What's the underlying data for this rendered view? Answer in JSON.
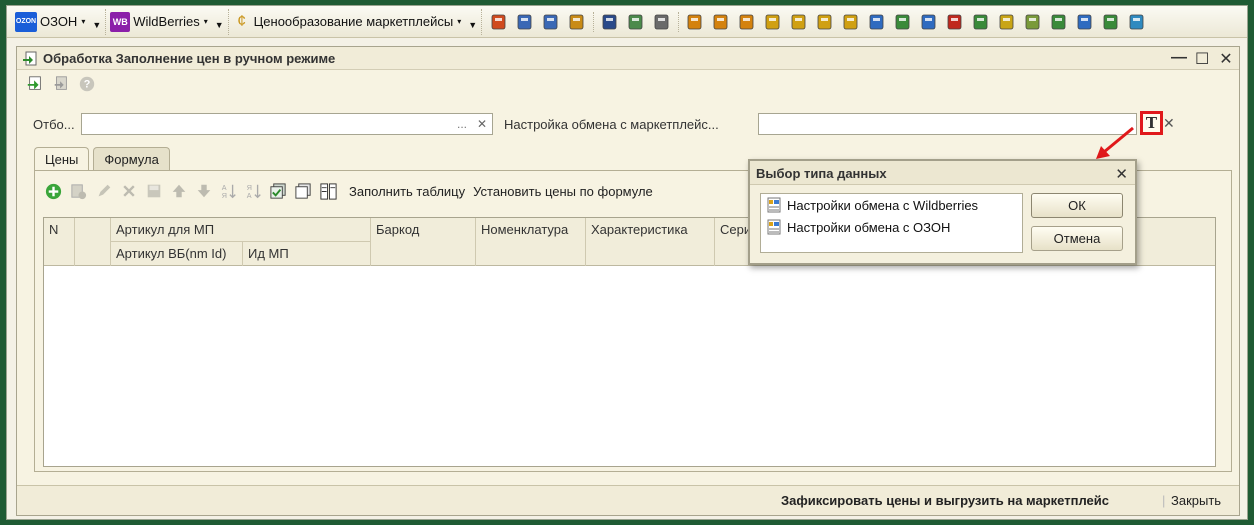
{
  "toolbar": {
    "ozon_label": "ОЗОН",
    "ozon_logo": "OZON",
    "wb_label": "WildBerries",
    "wb_logo": "WB",
    "pricing_label": "Ценообразование маркетплейсы",
    "icons": [
      "book-icon",
      "print-icon",
      "printer-icon",
      "printer2-icon",
      "users-icon",
      "table-icon",
      "chart-icon",
      "money-icon",
      "money2-icon",
      "money3-icon",
      "coins-icon",
      "bars-icon",
      "coins2-icon",
      "currency-icon",
      "export-icon",
      "transfer-icon",
      "export2-icon",
      "transfer2-icon",
      "transfer3-icon",
      "stack-icon",
      "document-icon",
      "transfer4-icon",
      "export3-icon",
      "refresh-icon",
      "add-table-icon"
    ]
  },
  "window": {
    "title": "Обработка  Заполнение цен в ручном режиме",
    "controls": {
      "minimize": "—",
      "maximize": "☐",
      "close": "✕"
    }
  },
  "form": {
    "filter_label": "Отбо...",
    "filter_value": "",
    "filter_choose": "...",
    "exchange_label": "Настройка обмена с маркетплейс...",
    "exchange_value": "",
    "type_button": "T"
  },
  "tabs": [
    {
      "label": "Цены",
      "active": true
    },
    {
      "label": "Формула",
      "active": false
    }
  ],
  "tab_toolbar": {
    "fill_table": "Заполнить таблицу",
    "set_prices": "Установить цены по формуле"
  },
  "table": {
    "headers": {
      "n": "N",
      "article_mp": "Артикул для МП",
      "article_wb": "Артикул ВБ(nm Id)",
      "id_mp": "Ид МП",
      "barcode": "Баркод",
      "nomenclature": "Номенклатура",
      "characteristic": "Характеристика",
      "series": "Серия"
    },
    "rows": []
  },
  "footer": {
    "commit": "Зафиксировать цены и выгрузить на маркетплейс",
    "close": "Закрыть"
  },
  "dialog": {
    "title": "Выбор типа данных",
    "items": [
      "Настройки обмена с Wildberries",
      "Настройки обмена с ОЗОН"
    ],
    "ok": "ОК",
    "cancel": "Отмена"
  },
  "colors": {
    "background": "#1f5b34",
    "annotation_red": "#e0191b",
    "window_bg": "#f7f3e2"
  }
}
